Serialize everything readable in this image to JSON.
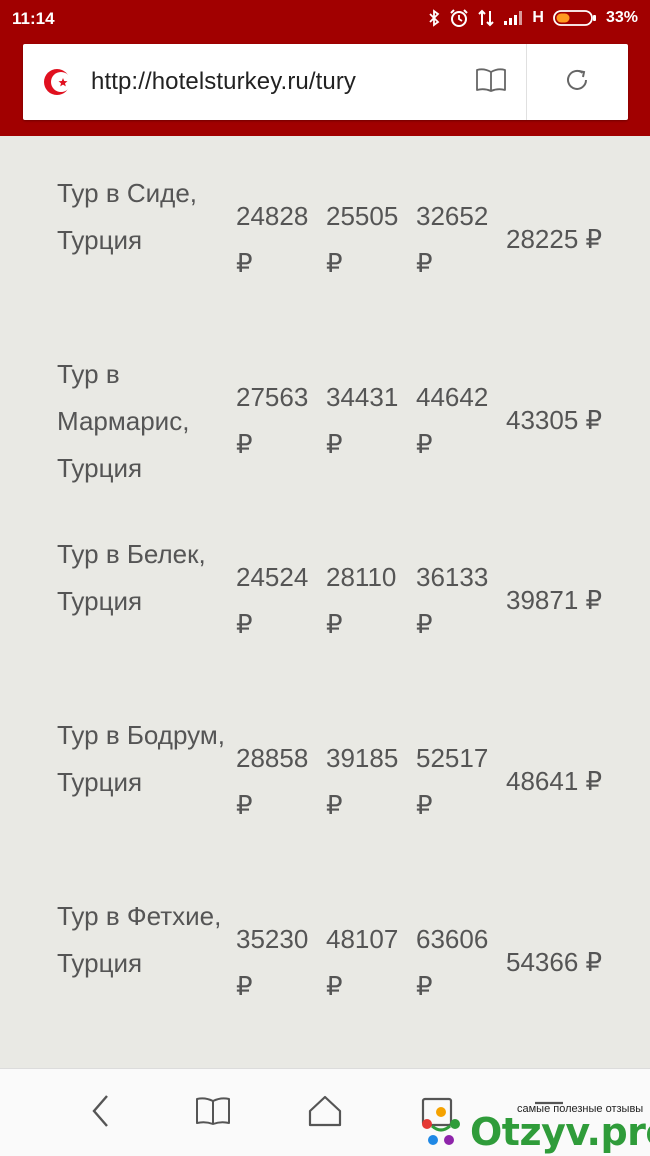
{
  "status_bar": {
    "time": "11:14",
    "network": "H",
    "battery": "33%"
  },
  "browser": {
    "url": "http://hotelsturkey.ru/tury",
    "reader_icon": "book-icon",
    "reload_icon": "reload-icon",
    "theme_color": "#a10000"
  },
  "tours": [
    {
      "name": "Тур в Сиде, Турция",
      "prices": [
        "24828 ₽",
        "25505 ₽",
        "32652 ₽"
      ],
      "avg": "28225 ₽"
    },
    {
      "name": "Тур в Мармарис, Турция",
      "prices": [
        "27563 ₽",
        "34431 ₽",
        "44642 ₽"
      ],
      "avg": "43305 ₽"
    },
    {
      "name": "Тур в Белек, Турция",
      "prices": [
        "24524 ₽",
        "28110 ₽",
        "36133 ₽"
      ],
      "avg": "39871 ₽"
    },
    {
      "name": "Тур в Бодрум, Турция",
      "prices": [
        "28858 ₽",
        "39185 ₽",
        "52517 ₽"
      ],
      "avg": "48641 ₽"
    },
    {
      "name": "Тур в Фетхие, Турция",
      "prices": [
        "35230 ₽",
        "48107 ₽",
        "63606 ₽"
      ],
      "avg": "54366 ₽"
    }
  ],
  "watermark": {
    "tagline": "самые полезные отзывы",
    "logo": "Otzyv.pro"
  }
}
